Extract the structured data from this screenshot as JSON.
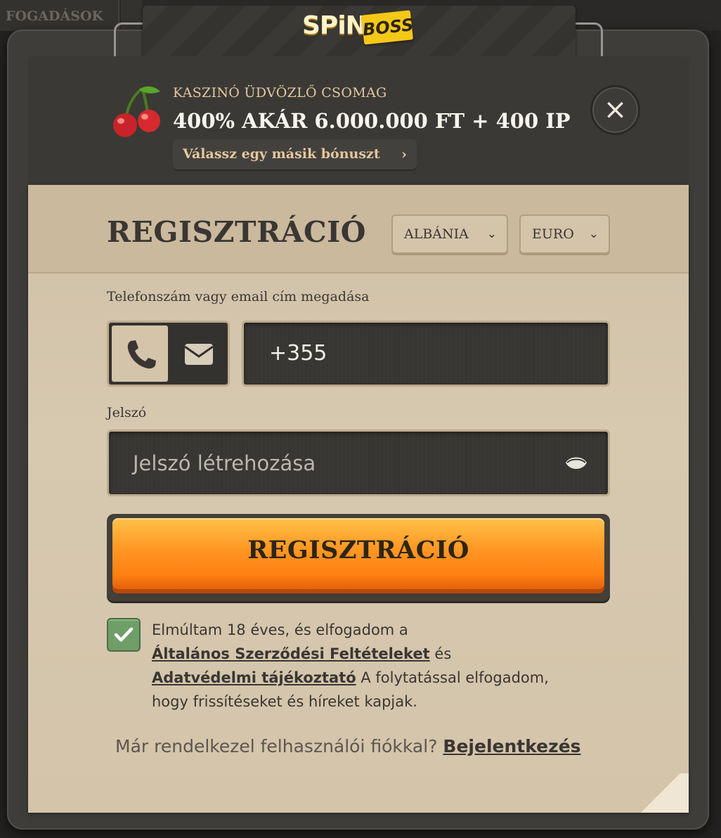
{
  "background": {
    "tab_label": "FOGADÁSOK"
  },
  "logo": {
    "spin": "SPiN",
    "boss": "BOSS"
  },
  "bonus": {
    "subtitle": "KASZINÓ ÜDVÖZLŐ CSOMAG",
    "title": "400% AKÁR 6.000.000 FT + 400 IP",
    "choose_other_label": "Válassz egy másik bónuszt"
  },
  "registration": {
    "title": "REGISZTRÁCIÓ",
    "country_select": "ALBÁNIA",
    "currency_select": "EURO",
    "contact_label": "Telefonszám vagy email cím megadása",
    "phone_value": "+355",
    "password_label": "Jelszó",
    "password_placeholder": "Jelszó létrehozása",
    "submit_label": "REGISZTRÁCIÓ",
    "terms_checked": true,
    "consent_text_1": "Elmúltam 18 éves, és elfogadom a",
    "terms_link": "Általános Szerződési Feltételeket",
    "consent_and": "és",
    "privacy_link": "Adatvédelmi tájékoztató",
    "consent_text_2": "A folytatással elfogadom, hogy frissítéseket és híreket kapjak.",
    "login_prompt": "Már rendelkezel felhasználói fiókkal?",
    "login_link": "Bejelentkezés"
  },
  "colors": {
    "accent_orange": "#ff8c1a",
    "paper": "#d3c4aa",
    "dark_panel": "#3a3936",
    "checkbox_green": "#6f9e67"
  },
  "icons": [
    "cherry-icon",
    "chevron-right-icon",
    "close-icon",
    "chevron-down-icon",
    "phone-icon",
    "mail-icon",
    "eye-icon",
    "checkmark-icon"
  ]
}
